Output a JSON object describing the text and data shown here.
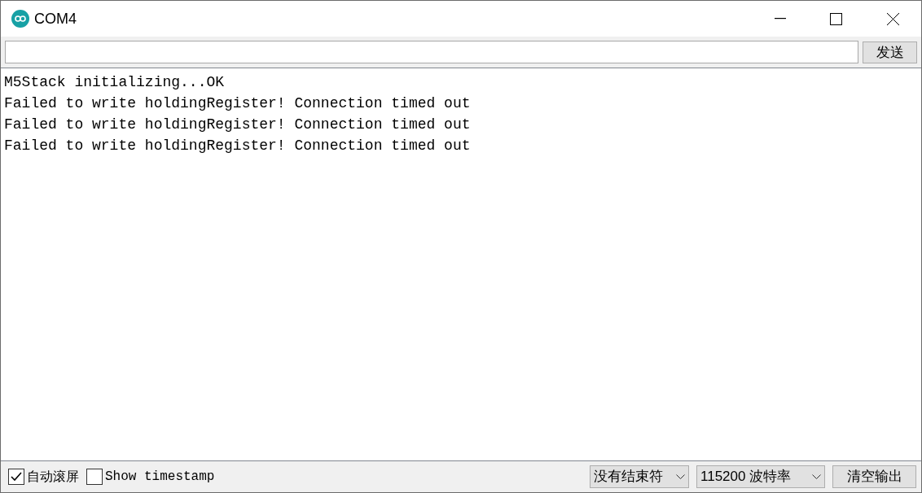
{
  "window": {
    "title": "COM4"
  },
  "send_button": "发送",
  "output_lines": [
    "M5Stack initializing...OK",
    "Failed to write holdingRegister! Connection timed out",
    "Failed to write holdingRegister! Connection timed out",
    "Failed to write holdingRegister! Connection timed out"
  ],
  "status_bar": {
    "checkboxes": [
      {
        "label": "自动滚屏",
        "checked": true
      },
      {
        "label": "Show timestamp",
        "checked": false
      }
    ],
    "dropdowns": [
      {
        "value": "没有结束符"
      },
      {
        "value": "115200 波特率"
      }
    ],
    "clear_button": "清空输出"
  }
}
